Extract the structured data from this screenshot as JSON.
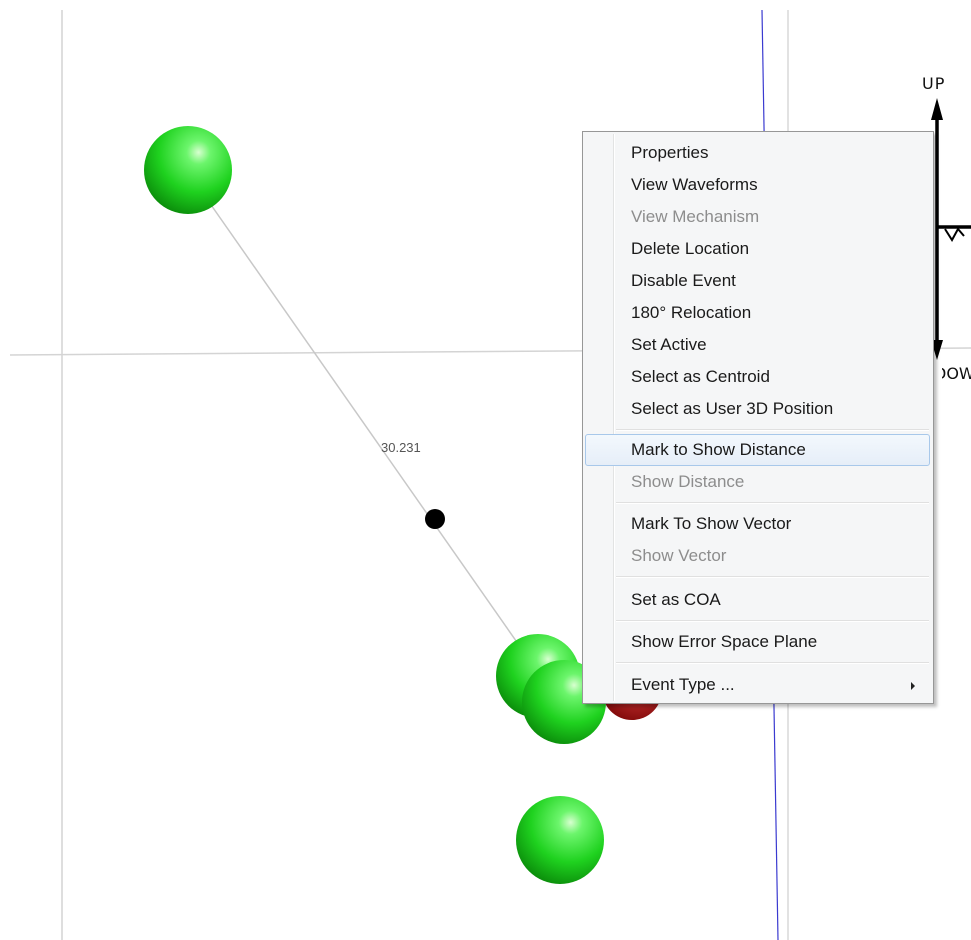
{
  "distance_label": "30.231",
  "orientation": {
    "up_label": "UP",
    "down_label": "DOWN"
  },
  "colors": {
    "event_sphere": "#22dd22",
    "event_sphere_highlight": "#b8ffb0",
    "event_sphere_shadow": "#0a8a0a",
    "selected_sphere": "#b01010",
    "link_line": "#c8c8c8",
    "grid_line": "#d4d4d4",
    "vertical_axis_line": "#3333cc",
    "midpoint_marker": "#000000",
    "menu_hover": "#e6eef8"
  },
  "context_menu": {
    "items": [
      {
        "label": "Properties",
        "enabled": true
      },
      {
        "label": "View Waveforms",
        "enabled": true
      },
      {
        "label": "View Mechanism",
        "enabled": false
      },
      {
        "label": "Delete Location",
        "enabled": true
      },
      {
        "label": "Disable Event",
        "enabled": true
      },
      {
        "label": "180° Relocation",
        "enabled": true
      },
      {
        "label": "Set Active",
        "enabled": true
      },
      {
        "label": "Select as Centroid",
        "enabled": true
      },
      {
        "label": "Select as User 3D Position",
        "enabled": true
      },
      {
        "label": "Mark to Show Distance",
        "enabled": true,
        "highlighted": true
      },
      {
        "label": "Show Distance",
        "enabled": false
      },
      {
        "label": "Mark To Show Vector",
        "enabled": true
      },
      {
        "label": "Show Vector",
        "enabled": false
      },
      {
        "label": "Set as COA",
        "enabled": true
      },
      {
        "label": "Show Error Space Plane",
        "enabled": true
      },
      {
        "label": "Event Type ...",
        "enabled": true,
        "has_submenu": true
      }
    ]
  }
}
